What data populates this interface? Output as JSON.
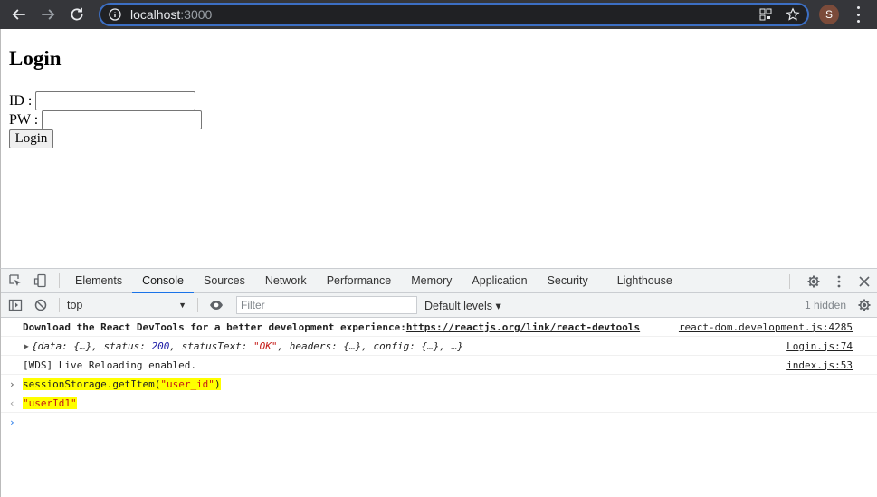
{
  "browser": {
    "url_host": "localhost",
    "url_port": ":3000",
    "avatar_letter": "S"
  },
  "page": {
    "title": "Login",
    "id_label": "ID :",
    "pw_label": "PW :",
    "login_button": "Login"
  },
  "devtools": {
    "tabs": [
      "Elements",
      "Console",
      "Sources",
      "Network",
      "Performance",
      "Memory",
      "Application",
      "Security",
      "Lighthouse"
    ],
    "active_tab": "Console",
    "context": "top",
    "filter_placeholder": "Filter",
    "levels": "Default levels ▾",
    "hidden": "1 hidden"
  },
  "console": {
    "line1_text": "Download the React DevTools for a better development experience: ",
    "line1_link": "https://reactjs.org/link/react-devtools",
    "line1_src": "react-dom.development.js:4285",
    "line2_a": "{data: {…}, status: ",
    "line2_status": "200",
    "line2_b": ", statusText: ",
    "line2_statustext": "\"OK\"",
    "line2_c": ", headers: {…}, config: {…}, …}",
    "line2_src": "Login.js:74",
    "line3_text": "[WDS] Live Reloading enabled.",
    "line3_src": "index.js:53",
    "cmd_prefix": "sessionStorage.getItem(",
    "cmd_arg": "\"user_id\"",
    "cmd_suffix": ")",
    "result": "\"userId1\""
  }
}
